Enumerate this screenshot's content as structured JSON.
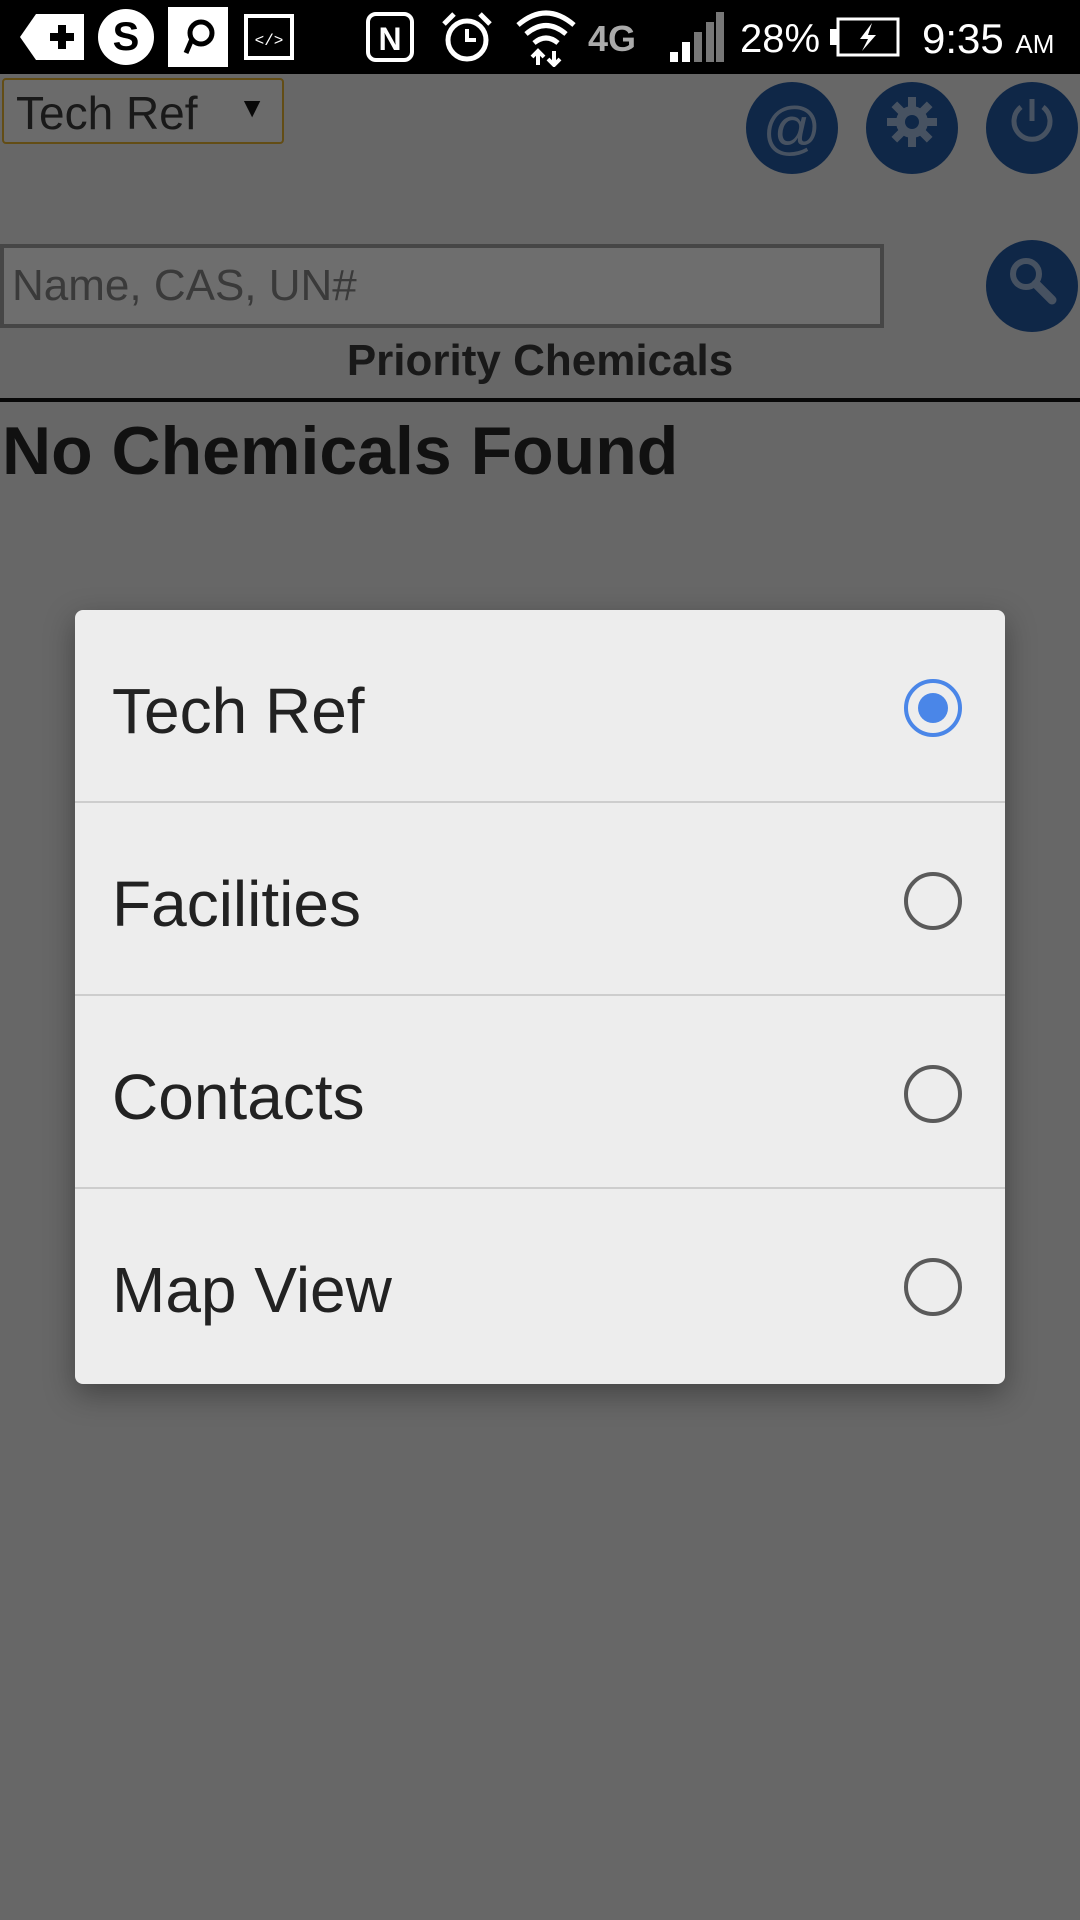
{
  "status_bar": {
    "battery": "28%",
    "time": "9:35",
    "ampm": "AM",
    "network": "4G"
  },
  "app": {
    "mode_select": {
      "value": "Tech Ref",
      "arrow": "▼"
    },
    "buttons": {
      "email_icon": "@",
      "settings_icon": "gear-icon",
      "power_icon": "power-icon",
      "search_icon": "search-icon"
    },
    "search": {
      "placeholder": "Name, CAS, UN#"
    },
    "section_title": "Priority Chemicals",
    "empty_message": "No Chemicals Found"
  },
  "dialog": {
    "options": [
      {
        "label": "Tech Ref",
        "selected": true
      },
      {
        "label": "Facilities",
        "selected": false
      },
      {
        "label": "Contacts",
        "selected": false
      },
      {
        "label": "Map View",
        "selected": false
      }
    ]
  },
  "colors": {
    "accent": "#4a86e8",
    "button_blue": "#1f4f8f",
    "select_border": "#c79a2a"
  }
}
